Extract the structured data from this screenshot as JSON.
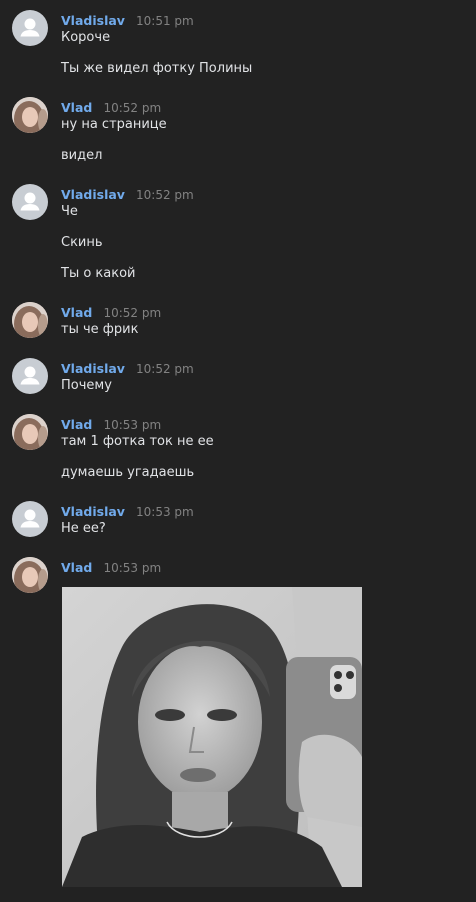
{
  "messages": [
    {
      "author": "Vladislav",
      "time": "10:51 pm",
      "avatar": "default-user-icon",
      "lines": [
        "Короче",
        "Ты же видел фотку Полины"
      ]
    },
    {
      "author": "Vlad",
      "time": "10:52 pm",
      "avatar": "user-photo",
      "lines": [
        "ну на странице",
        "видел"
      ]
    },
    {
      "author": "Vladislav",
      "time": "10:52 pm",
      "avatar": "default-user-icon",
      "lines": [
        "Че",
        "Скинь",
        "Ты о какой"
      ]
    },
    {
      "author": "Vlad",
      "time": "10:52 pm",
      "avatar": "user-photo",
      "lines": [
        "ты че фрик"
      ]
    },
    {
      "author": "Vladislav",
      "time": "10:52 pm",
      "avatar": "default-user-icon",
      "lines": [
        "Почему"
      ]
    },
    {
      "author": "Vlad",
      "time": "10:53 pm",
      "avatar": "user-photo",
      "lines": [
        "там 1 фотка ток не ее",
        "думаешь угадаешь"
      ]
    },
    {
      "author": "Vladislav",
      "time": "10:53 pm",
      "avatar": "default-user-icon",
      "lines": [
        "Не ее?"
      ]
    },
    {
      "author": "Vlad",
      "time": "10:53 pm",
      "avatar": "user-photo",
      "attachment": "photo-attachment",
      "lines": []
    }
  ],
  "colors": {
    "background": "#222222",
    "author_link": "#71aaeb",
    "timestamp": "#828282",
    "message_text": "#e1e3e6"
  }
}
